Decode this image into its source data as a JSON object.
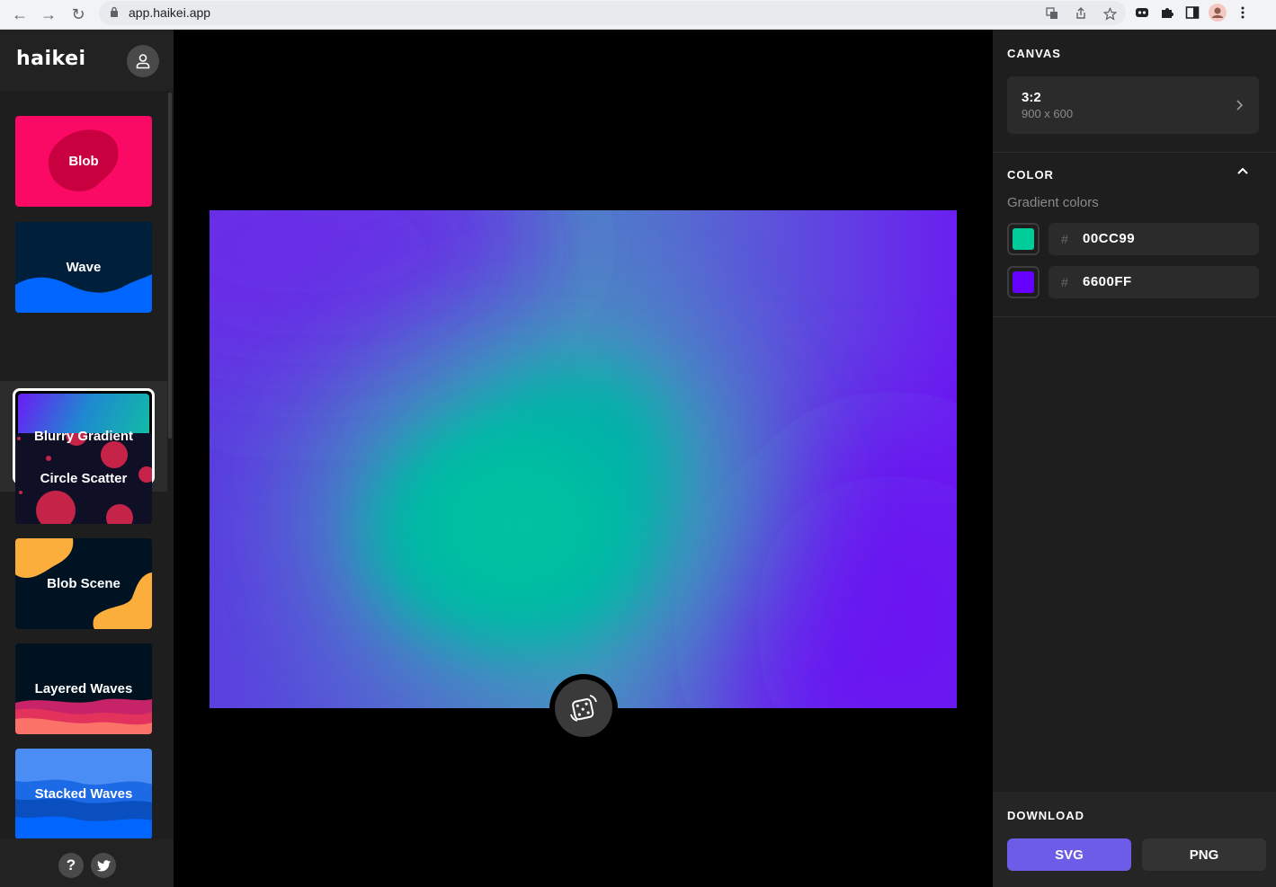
{
  "browser": {
    "url": "app.haikei.app"
  },
  "sidebar": {
    "logo": "haikei",
    "tiles": [
      {
        "label": "Blob"
      },
      {
        "label": "Wave"
      },
      {
        "label": "Blurry Gradient"
      },
      {
        "label": "Circle Scatter"
      },
      {
        "label": "Blob Scene"
      },
      {
        "label": "Layered Waves"
      },
      {
        "label": "Stacked Waves"
      }
    ],
    "help_label": "?"
  },
  "panel": {
    "canvas": {
      "title": "CANVAS",
      "ratio": "3:2",
      "size": "900 x 600"
    },
    "color": {
      "title": "COLOR",
      "sub_label": "Gradient colors",
      "colors": [
        {
          "hash": "#",
          "value": "00CC99",
          "hex": "#00CC99"
        },
        {
          "hash": "#",
          "value": "6600FF",
          "hex": "#6600FF"
        }
      ]
    },
    "download": {
      "title": "DOWNLOAD",
      "svg_label": "SVG",
      "png_label": "PNG"
    }
  }
}
